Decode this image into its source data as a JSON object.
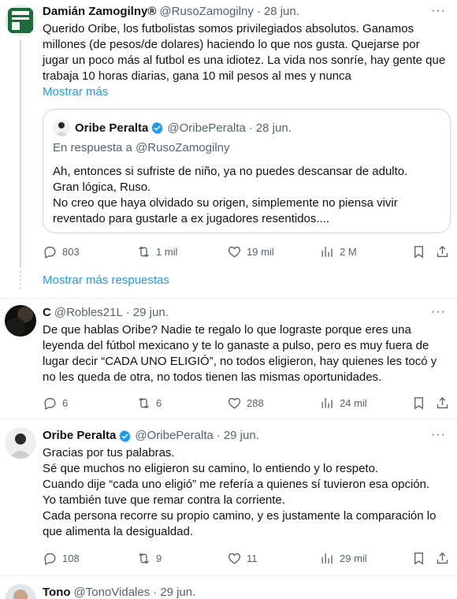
{
  "tweet1": {
    "name": "Damián Zamogilny®",
    "handle": "@RusoZamogilny",
    "date": "28 jun.",
    "text": "Querido Oribe, los futbolistas somos privilegiados absolutos. Ganamos millones (de pesos/de dolares) haciendo lo que nos gusta. Quejarse por jugar un poco más al futbol es una idiotez. La vida nos sonríe, hay gente que trabaja 10 horas diarias, gana 10 mil pesos al mes y nunca",
    "show_more": "Mostrar más",
    "quote": {
      "name": "Oribe Peralta",
      "handle": "@OribePeralta",
      "date": "28 jun.",
      "reply_to": "En respuesta a @RusoZamogilny",
      "text1": "Ah, entonces si sufriste de niño, ya no puedes descansar de adulto.",
      "text2": "Gran lógica, Ruso.",
      "text3": "No creo que haya olvidado su origen, simplemente no piensa vivir reventado para gustarle a ex jugadores resentidos...."
    },
    "replies": "803",
    "retweets": "1 mil",
    "likes": "19 mil",
    "views": "2 M"
  },
  "show_more_replies": "Mostrar más respuestas",
  "tweet2": {
    "name": "C",
    "handle": "@Robles21L",
    "date": "29 jun.",
    "text": "De que hablas Oribe? Nadie te regalo lo que lograste porque eres una leyenda del fútbol mexicano y te lo ganaste a pulso, pero es muy fuera de lugar decir “CADA UNO ELIGIÓ”, no todos eligieron, hay quienes les tocó y no les queda de otra, no todos tienen las mismas oportunidades.",
    "replies": "6",
    "retweets": "6",
    "likes": "288",
    "views": "24 mil"
  },
  "tweet3": {
    "name": "Oribe Peralta",
    "handle": "@OribePeralta",
    "date": "29 jun.",
    "line1": "Gracias por tus palabras.",
    "line2": "Sé que muchos no eligieron su camino, lo entiendo y lo respeto.",
    "line3": "Cuando dije “cada uno eligió” me refería a quienes sí tuvieron esa opción.",
    "line4": "Yo también tuve que remar contra la corriente.",
    "line5": "Cada persona recorre su propio camino, y es justamente la comparación lo que alimenta la desigualdad.",
    "replies": "108",
    "retweets": "9",
    "likes": "11",
    "views": "29 mil"
  },
  "tweet4": {
    "name": "Tono",
    "handle": "@TonoVidales",
    "date": "29 jun."
  },
  "colors": {
    "accent": "#1d9bf0",
    "muted": "#536471",
    "border": "#cfd9de"
  },
  "icons": [
    "more-icon",
    "verified-icon",
    "reply-icon",
    "retweet-icon",
    "like-icon",
    "views-icon",
    "bookmark-icon",
    "share-icon"
  ]
}
